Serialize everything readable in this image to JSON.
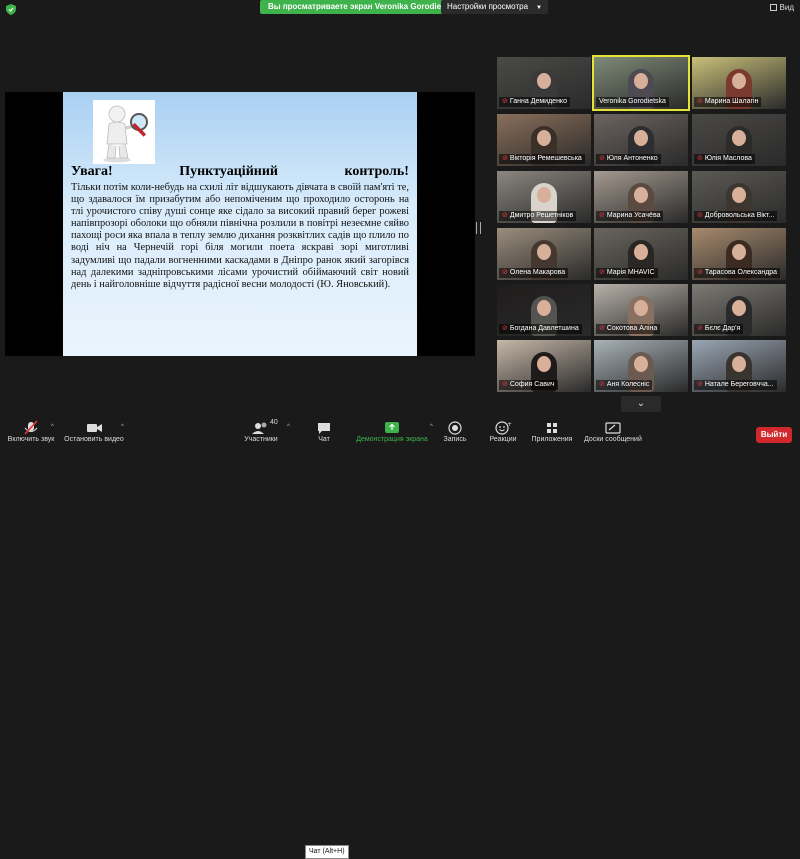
{
  "top_bar": {
    "sharing_banner": "Вы просматриваете экран Veronika Gorodietska",
    "view_settings": "Настройки просмотра",
    "view_button": "Вид"
  },
  "slide": {
    "heading_left": "Увага!",
    "heading_mid": "Пунктуаційний",
    "heading_right": "контроль!",
    "text": "Тільки потім коли-небудь на схилі літ відшукають дівчата в своїй пам'яті те, що здавалося їм призабутим або непоміченим що проходило осторонь на тлі урочистого співу душі сонце яке сідало за високий правий берег рожеві напівпрозорі оболоки що обняли північна розлили в повітрі незеємне сяйво пахощі роси яка впала в теплу землю дихання розквітлих садів що плило по воді ніч на Чернечій горі біля могили поета яскраві зорі миготливі задумливі що падали вогненними каскадами в Дніпро ранок який загорівся над далекими задніпровськими лісами урочистий обіймаючий світ новий день і найголовніше відчуття радісної весни молодості (Ю. Яновський)."
  },
  "participants": [
    {
      "name": "Ганна Демиденко",
      "muted": true,
      "bg": "#4a4a48",
      "shirt": "#3a3a3a",
      "active": false
    },
    {
      "name": "Veronika Gorodietska",
      "muted": false,
      "bg": "#7e8b77",
      "shirt": "#4d4a52",
      "active": true
    },
    {
      "name": "Марина Шалагін",
      "muted": true,
      "bg": "#c9c07a",
      "shirt": "#7a3a2e",
      "active": false
    },
    {
      "name": "Вікторія Ремешевська",
      "muted": true,
      "bg": "#8a6f5a",
      "shirt": "#3a302a",
      "active": false
    },
    {
      "name": "Юля Антоненко",
      "muted": true,
      "bg": "#6c6460",
      "shirt": "#2e2e30",
      "active": false
    },
    {
      "name": "Юлія Маслова",
      "muted": true,
      "bg": "#4b4946",
      "shirt": "#2c2b2a",
      "active": false
    },
    {
      "name": "Дмитро Решетніков",
      "muted": true,
      "bg": "#8b8780",
      "shirt": "#d8d4cc",
      "active": false
    },
    {
      "name": "Марина Усачёва",
      "muted": true,
      "bg": "#a49a90",
      "shirt": "#5a4a40",
      "active": false
    },
    {
      "name": "Добровольська Вікт...",
      "muted": true,
      "bg": "#5c5a55",
      "shirt": "#3d3530",
      "active": false
    },
    {
      "name": "Олена Макарова",
      "muted": true,
      "bg": "#9a8d7c",
      "shirt": "#443830",
      "active": false
    },
    {
      "name": "Марія MHAVIC",
      "muted": true,
      "bg": "#6a665e",
      "shirt": "#2a2624",
      "active": false
    },
    {
      "name": "Тарасова Олександра",
      "muted": true,
      "bg": "#a78a6d",
      "shirt": "#3a2a22",
      "active": false
    },
    {
      "name": "Богдана Давлетшина",
      "muted": true,
      "bg": "#1f1d1c",
      "shirt": "#555350",
      "active": false
    },
    {
      "name": "Сокотова Аліна",
      "muted": true,
      "bg": "#b7b1a8",
      "shirt": "#8a7060",
      "active": false
    },
    {
      "name": "Бєлє Дар'я",
      "muted": true,
      "bg": "#7d7a74",
      "shirt": "#2a2a2a",
      "active": false
    },
    {
      "name": "София Савич",
      "muted": true,
      "bg": "#c6b8a8",
      "shirt": "#1f1b1a",
      "active": false
    },
    {
      "name": "Аня Колесніс",
      "muted": true,
      "bg": "#a8b2b8",
      "shirt": "#6a5a50",
      "active": false
    },
    {
      "name": "Натале Береговчча...",
      "muted": true,
      "bg": "#9aa6b4",
      "shirt": "#3a3430",
      "active": false
    }
  ],
  "toolbar": {
    "mute": "Включить звук",
    "video": "Остановить видео",
    "participants": "Участники",
    "participants_count": "40",
    "chat": "Чат",
    "chat_tooltip": "Чат (Alt+H)",
    "share": "Демонстрация экрана",
    "record": "Запись",
    "reactions": "Реакции",
    "apps": "Приложения",
    "whiteboard": "Доски сообщений",
    "leave": "Выйти"
  },
  "colors": {
    "share_green": "#3eb34b",
    "leave_red": "#d0282d",
    "active_speaker": "#e7e335",
    "muted_red": "#e0383e"
  },
  "icons": [
    "shield-icon",
    "grid-view-icon",
    "magnifier-figure-image",
    "mic-off-icon",
    "camera-icon",
    "participants-icon",
    "chat-icon",
    "share-screen-icon",
    "record-icon",
    "reactions-icon",
    "apps-icon",
    "whiteboard-icon",
    "chevron-down-icon",
    "caret-up-icon"
  ]
}
